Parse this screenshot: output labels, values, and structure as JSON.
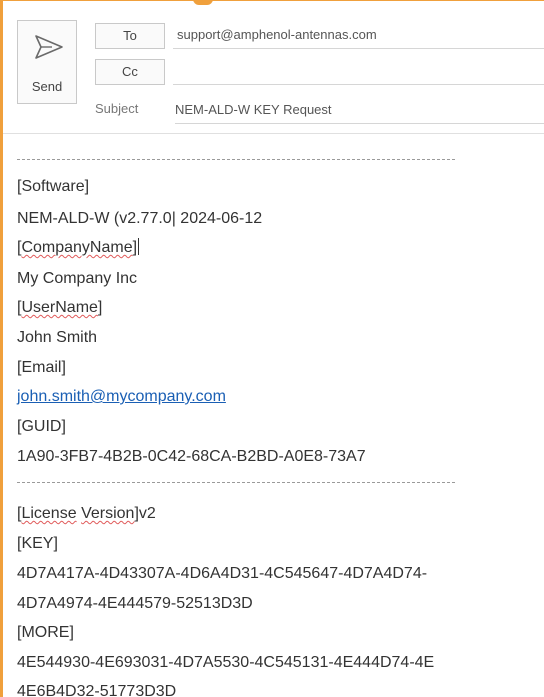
{
  "header": {
    "send_label": "Send",
    "to_label": "To",
    "cc_label": "Cc",
    "subject_label": "Subject",
    "to_value": "support@amphenol-antennas.com",
    "cc_value": "",
    "subject_value": "NEM-ALD-W KEY Request"
  },
  "body": {
    "software_tag": "[Software]",
    "software_value": "NEM-ALD-W (v2.77.0| 2024-06-12",
    "company_tag_open": "[",
    "company_tag_word": "CompanyName",
    "company_tag_close": "]",
    "company_value": "My Company Inc",
    "user_tag_open": "[",
    "user_tag_word": "UserName",
    "user_tag_close": "]",
    "user_value": "John Smith",
    "email_tag": "[Email]",
    "email_value": "john.smith@mycompany.com",
    "guid_tag": "[GUID]",
    "guid_value": "1A90-3FB7-4B2B-0C42-68CA-B2BD-A0E8-73A7",
    "license_open": "[",
    "license_word1": "License",
    "license_space": " ",
    "license_word2": "Version",
    "license_close": "]v2",
    "key_tag": "[KEY]",
    "key_line1": "4D7A417A-4D43307A-4D6A4D31-4C545647-4D7A4D74-",
    "key_line2": "4D7A4974-4E444579-52513D3D",
    "more_tag": "[MORE]",
    "more_line1": "4E544930-4E693031-4D7A5530-4C545131-4E444D74-4E",
    "more_line2": "4E6B4D32-51773D3D"
  }
}
